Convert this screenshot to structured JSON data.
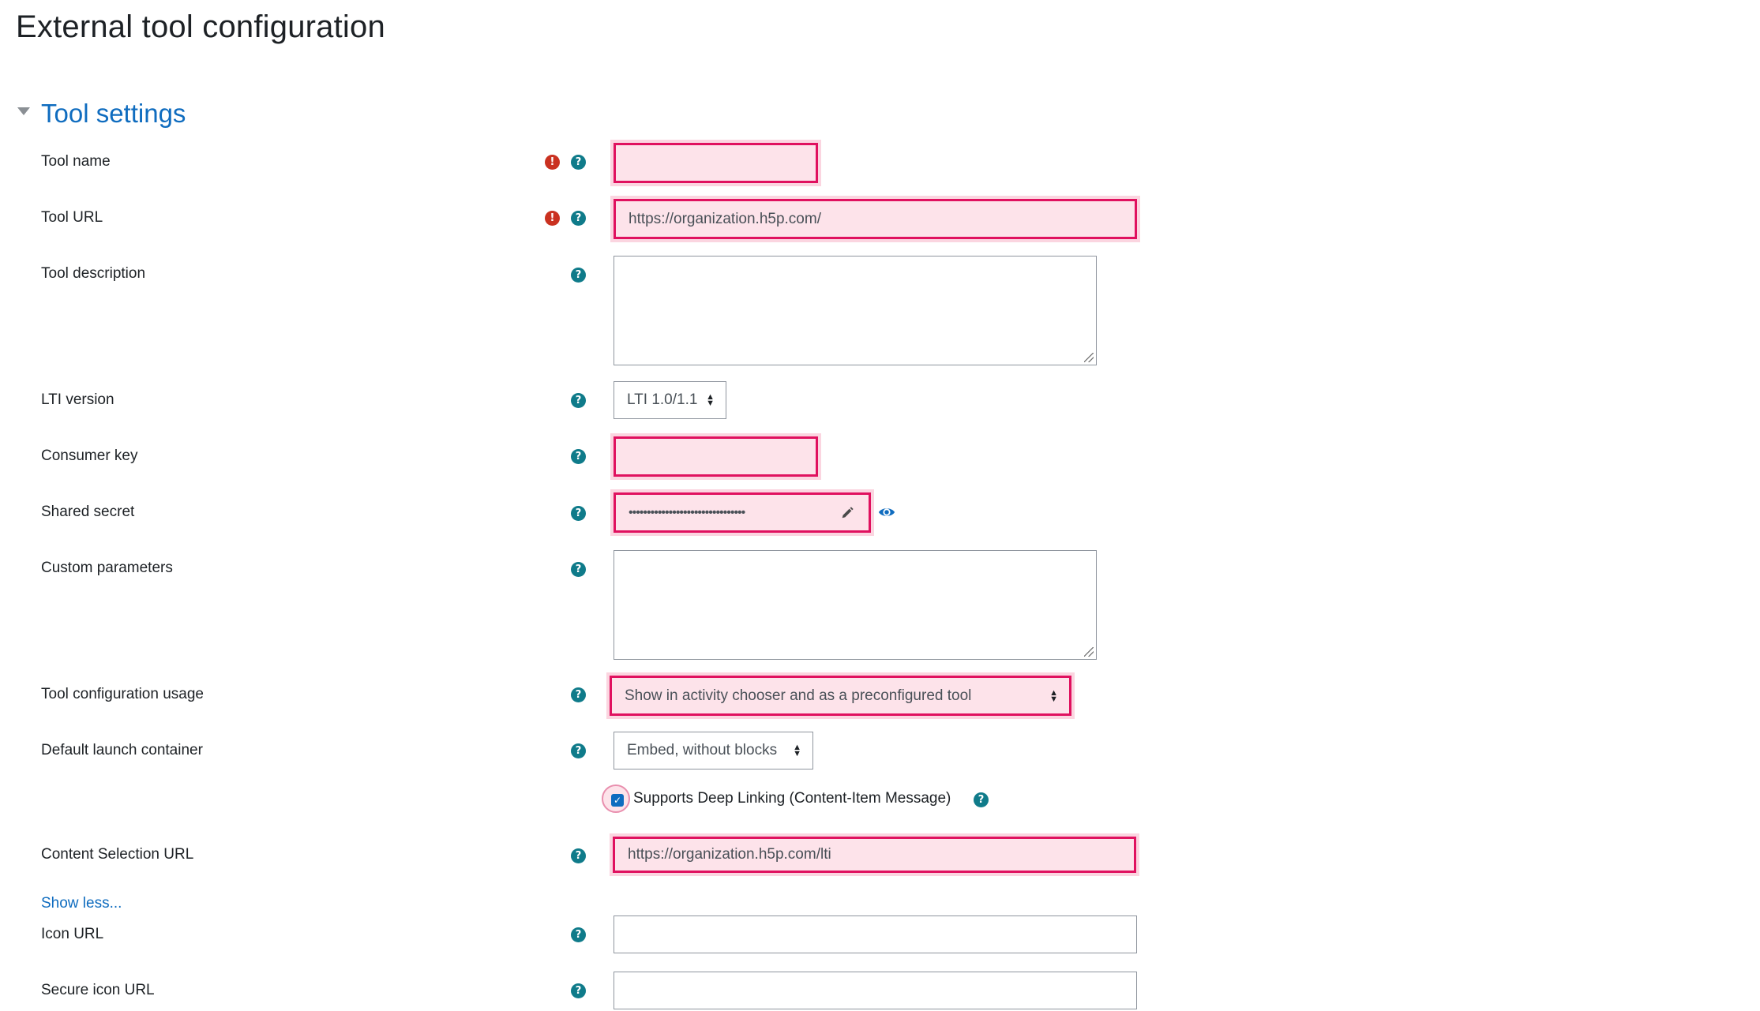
{
  "page": {
    "title": "External tool configuration"
  },
  "section": {
    "title": "Tool settings"
  },
  "fields": {
    "tool_name": {
      "label": "Tool name",
      "value": ""
    },
    "tool_url": {
      "label": "Tool URL",
      "value": "https://organization.h5p.com/"
    },
    "tool_description": {
      "label": "Tool description",
      "value": ""
    },
    "lti_version": {
      "label": "LTI version",
      "value": "LTI 1.0/1.1"
    },
    "consumer_key": {
      "label": "Consumer key",
      "value": ""
    },
    "shared_secret": {
      "label": "Shared secret",
      "value": "••••••••••••••••••••••••••••••••"
    },
    "custom_parameters": {
      "label": "Custom parameters",
      "value": ""
    },
    "tool_configuration_usage": {
      "label": "Tool configuration usage",
      "value": "Show in activity chooser and as a preconfigured tool"
    },
    "default_launch_container": {
      "label": "Default launch container",
      "value": "Embed, without blocks"
    },
    "deep_linking": {
      "label": "Supports Deep Linking (Content-Item Message)",
      "checked": true
    },
    "content_selection_url": {
      "label": "Content Selection URL",
      "value": "https://organization.h5p.com/lti"
    },
    "icon_url": {
      "label": "Icon URL",
      "value": ""
    },
    "secure_icon_url": {
      "label": "Secure icon URL",
      "value": ""
    }
  },
  "links": {
    "show_less": "Show less..."
  },
  "icons": {
    "help": "help-icon",
    "required": "required-icon",
    "reveal": "eye-icon",
    "edit": "pencil-icon",
    "collapse": "caret-down-icon"
  },
  "colors": {
    "accent": "#0f6cbf",
    "help_icon": "#0f7b8a",
    "required_icon": "#ca3120",
    "invalid_border": "#e0115f",
    "invalid_background": "#fde3ea"
  }
}
